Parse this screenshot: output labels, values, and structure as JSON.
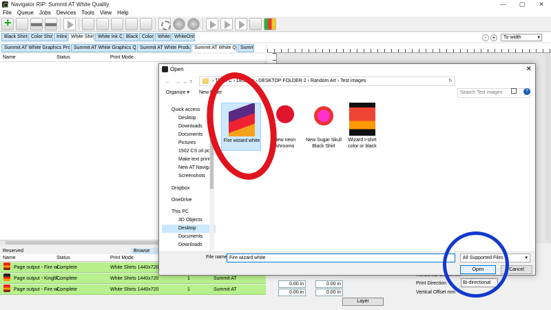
{
  "window": {
    "title": "Navigator RIP: Summit AT White Quality",
    "controls": [
      "—",
      "▢",
      "✕"
    ]
  },
  "menu": [
    "File",
    "Queue",
    "Jobs",
    "Devices",
    "Tools",
    "View",
    "Help"
  ],
  "tabs_row1": [
    "Black Shirts",
    "Color Shirts",
    "Inline",
    "White Shirts",
    "White Ink Only",
    "Black",
    "Color",
    "White",
    "WhiteOnly"
  ],
  "tabs_row2": [
    "Summit AT White Graphics Production",
    "Summit AT White Graphics Quality",
    "Summit AT White Production",
    "Summit AT White Quality",
    "Summit"
  ],
  "zoom": {
    "minus": "-",
    "plus": "+",
    "value": "To width"
  },
  "jobs_columns": [
    "Name",
    "Status",
    "Print Mode"
  ],
  "bottom_tabs": [
    "Reserved",
    "Browse"
  ],
  "bottom_columns": [
    "Name",
    "Status",
    "Print Mode"
  ],
  "bottom_rows": [
    {
      "name": "Page output - Fire wi...",
      "status": "Complete",
      "mode": "White Shirts 1440x720",
      "copies": "",
      "device": ""
    },
    {
      "name": "Page output - Kinglif...",
      "status": "Complete",
      "mode": "White Shirts 1440x720",
      "copies": "1",
      "device": "Summit AT"
    },
    {
      "name": "Page output - Fire wi...",
      "status": "Complete",
      "mode": "White Shirts 1440x720",
      "copies": "1",
      "device": "Summit AT"
    }
  ],
  "props": {
    "offset1": "0.00 in",
    "offset2": "0.00 in",
    "offset3": "0.00 in",
    "offset4": "0.00 in",
    "horizontal_label": "Horizontal Offset mm",
    "print_direction_label": "Print Direction",
    "print_direction_value": "Bi-directional",
    "vertical_label": "Vertical Offset mm",
    "layer_button": "Layer"
  },
  "dialog": {
    "title": "Open",
    "close": "✕",
    "address": {
      "path": [
        "This PC",
        "Desktop",
        "DESKTOP FOLDER 2",
        "Random Art",
        "Test images"
      ],
      "separator": "›"
    },
    "search_placeholder": "Search Test images",
    "organize": "Organize ▾",
    "new_folder": "New folder",
    "help": "?",
    "nav_items": [
      {
        "label": "Quick access",
        "color": "#2e7bd6"
      },
      {
        "label": "Desktop",
        "color": "#3b8fd9"
      },
      {
        "label": "Downloads",
        "color": "#2b6fc4"
      },
      {
        "label": "Documents",
        "color": "#6d8fb8"
      },
      {
        "label": "Pictures",
        "color": "#4aa3df"
      },
      {
        "label": "1502 CS oil poin",
        "color": "#f5d26b"
      },
      {
        "label": "Make text print r",
        "color": "#f5d26b"
      },
      {
        "label": "New AT Navigat",
        "color": "#f5d26b"
      },
      {
        "label": "Screenshots",
        "color": "#f5d26b"
      },
      {
        "label": "Dropbox",
        "color": "#0061fe"
      },
      {
        "label": "OneDrive",
        "color": "#0a64c8"
      },
      {
        "label": "This PC",
        "color": "#4a90d9"
      },
      {
        "label": "3D Objects",
        "color": "#7fb3e6"
      },
      {
        "label": "Desktop",
        "color": "#3b8fd9"
      },
      {
        "label": "Documents",
        "color": "#6d8fb8"
      },
      {
        "label": "Downloads",
        "color": "#2b6fc4"
      }
    ],
    "files": [
      {
        "label": "Fire wizard white",
        "selected": true
      },
      {
        "label": "new neon shrooms",
        "selected": false
      },
      {
        "label": "New Sugar Skull Black Shirt",
        "selected": false
      },
      {
        "label": "Wizard t-shirt color or black",
        "selected": false
      }
    ],
    "file_name_label": "File name:",
    "file_name_value": "Fire wizard white",
    "file_type": "All Supported Files",
    "open_button": "Open",
    "cancel_button": "Cancel"
  },
  "colors": {
    "tab_bg": "#cfe6f7",
    "row_green": "#b7f08c",
    "selection": "#cce8ff",
    "annotation_red": "#e0141e",
    "annotation_blue": "#1238cc"
  }
}
